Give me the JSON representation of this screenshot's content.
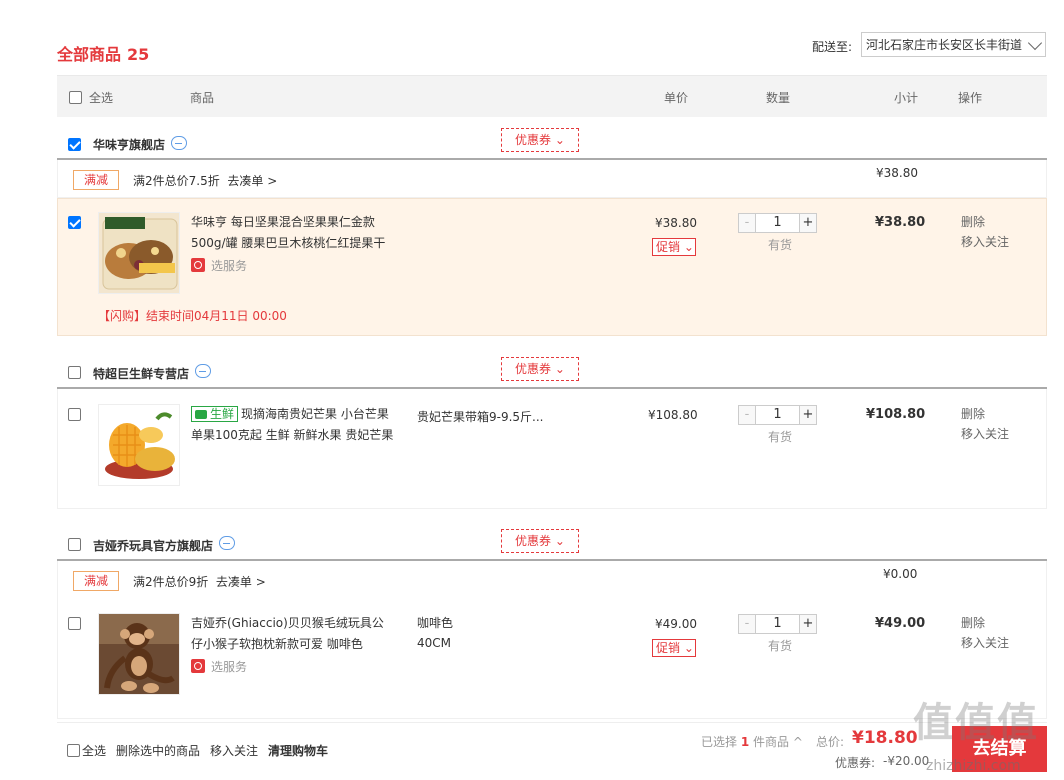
{
  "header": {
    "title": "全部商品",
    "count": "25",
    "ship_label": "配送至:",
    "ship_address": "河北石家庄市长安区长丰街道"
  },
  "table_head": {
    "select_all": "全选",
    "product": "商品",
    "unit_price": "单价",
    "quantity": "数量",
    "subtotal": "小计",
    "action": "操作"
  },
  "shops": [
    {
      "name": "华味亨旗舰店",
      "coupon": "优惠券",
      "checked": true,
      "promo": {
        "tag": "满减",
        "text": "满2件总价7.5折",
        "link": "去凑单 >",
        "amount": "¥38.80"
      },
      "item": {
        "name_line1": "华味亨 每日坚果混合坚果果仁金款",
        "name_line2": "500g/罐 腰果巴旦木核桃仁红提果干",
        "service": "选服务",
        "price": "¥38.80",
        "promo_btn": "促销",
        "qty": "1",
        "stock": "有货",
        "subtotal": "¥38.80",
        "op_delete": "删除",
        "op_follow": "移入关注",
        "flash": "【闪购】结束时间04月11日 00:00",
        "checked": true
      }
    },
    {
      "name": "特超巨生鲜专营店",
      "coupon": "优惠券",
      "checked": false,
      "item": {
        "fresh_tag": "生鲜",
        "name_line1": "现摘海南贵妃芒果 小台芒果",
        "name_line2": "单果100克起 生鲜 新鲜水果 贵妃芒果",
        "spec": "贵妃芒果带箱9-9.5斤...",
        "price": "¥108.80",
        "qty": "1",
        "stock": "有货",
        "subtotal": "¥108.80",
        "op_delete": "删除",
        "op_follow": "移入关注",
        "checked": false
      }
    },
    {
      "name": "吉娅乔玩具官方旗舰店",
      "coupon": "优惠券",
      "checked": false,
      "promo": {
        "tag": "满减",
        "text": "满2件总价9折",
        "link": "去凑单 >",
        "amount": "¥0.00"
      },
      "item": {
        "name_line1": "吉娅乔(Ghiaccio)贝贝猴毛绒玩具公",
        "name_line2": "仔小猴子软抱枕新款可爱 咖啡色",
        "service": "选服务",
        "spec_line1": "咖啡色",
        "spec_line2": "40CM",
        "price": "¥49.00",
        "promo_btn": "促销",
        "qty": "1",
        "stock": "有货",
        "subtotal": "¥49.00",
        "op_delete": "删除",
        "op_follow": "移入关注",
        "checked": false
      }
    }
  ],
  "footer": {
    "select_all": "全选",
    "delete_selected": "删除选中的商品",
    "move_follow": "移入关注",
    "clear_cart": "清理购物车",
    "selected_prefix": "已选择",
    "selected_count": "1",
    "selected_suffix": "件商品",
    "total_label": "总价:",
    "total": "¥18.80",
    "discount_label": "优惠券:",
    "discount": "-¥20.00",
    "checkout": "去结算"
  },
  "watermark": {
    "main": "值值值",
    "sub": "zhizhizhi.com"
  },
  "colors": {
    "accent": "#e4393c",
    "highlight_row": "#fff4e8",
    "checkbox": "#0075ff"
  }
}
